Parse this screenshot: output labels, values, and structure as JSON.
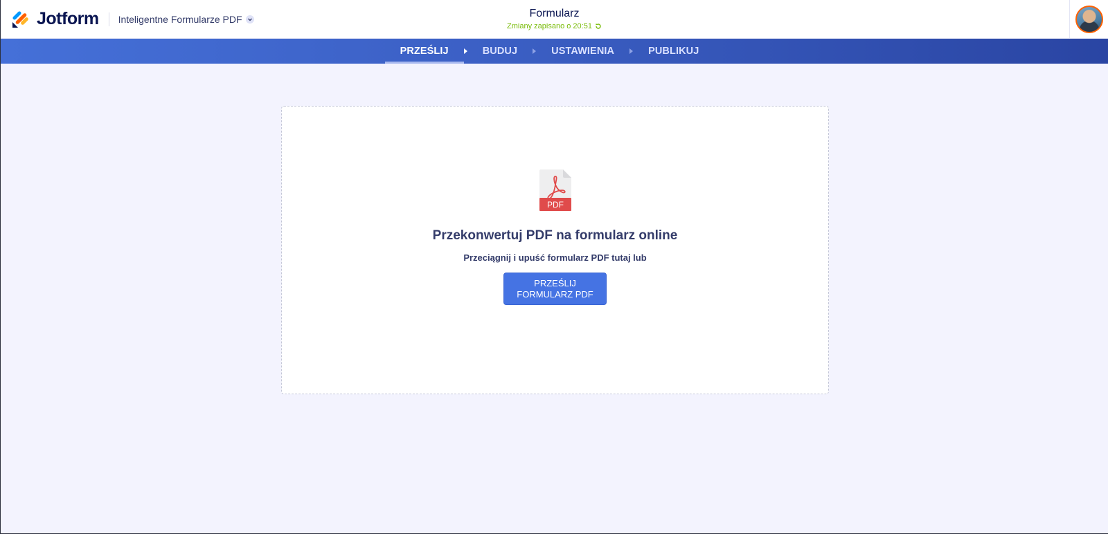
{
  "header": {
    "logo_text": "Jotform",
    "logo_icon": "jotform-logo-icon",
    "product_switch_label": "Inteligentne Formularze PDF",
    "product_switch_icon": "chevron-down-icon",
    "form_title": "Formularz",
    "save_status": "Zmiany zapisano o 20:51",
    "save_status_icon": "refresh-icon",
    "avatar_icon": "user-avatar"
  },
  "nav": {
    "tabs": [
      {
        "label": "PRZEŚLIJ",
        "active": true
      },
      {
        "label": "BUDUJ",
        "active": false
      },
      {
        "label": "USTAWIENIA",
        "active": false
      },
      {
        "label": "PUBLIKUJ",
        "active": false
      }
    ],
    "separator_icon": "chevron-right-icon"
  },
  "upload": {
    "file_icon": "pdf-file-icon",
    "file_icon_label": "PDF",
    "title": "Przekonwertuj PDF na formularz online",
    "subtitle": "Przeciągnij i upuść formularz PDF tutaj lub",
    "button_label": "PRZEŚLIJ FORMULARZ PDF"
  },
  "colors": {
    "accent": "#4573e3",
    "nav_start": "#4570d8",
    "nav_end": "#2a45a3",
    "save_status": "#78bb07",
    "background": "#f3f3fe",
    "pdf_red": "#e04b4b"
  }
}
